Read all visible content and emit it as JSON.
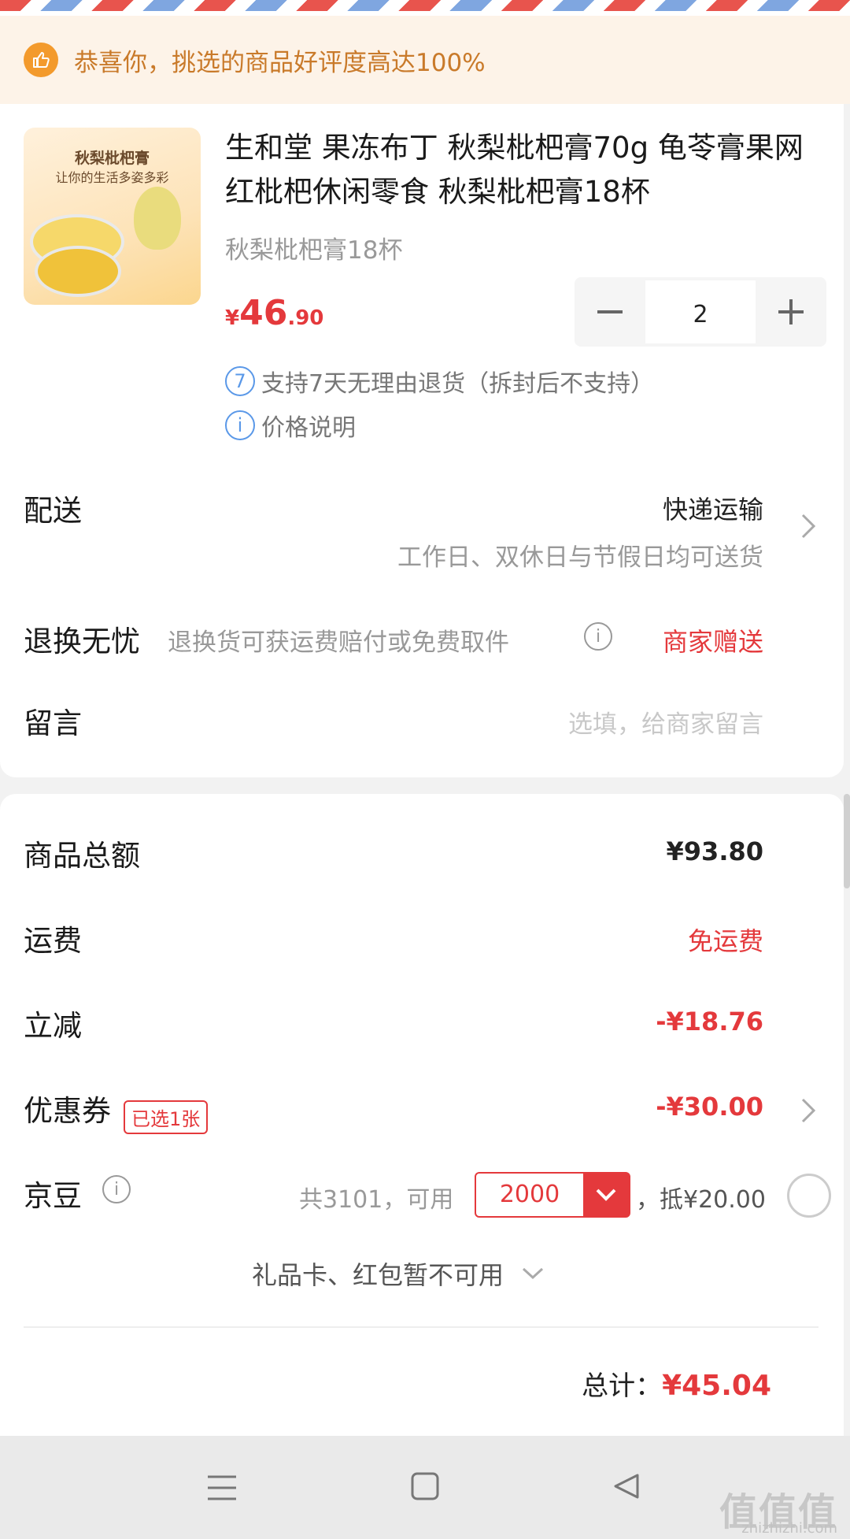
{
  "banner": {
    "icon": "thumbs-up-icon",
    "text": "恭喜你，挑选的商品好评度高达100%"
  },
  "product": {
    "image_line1": "秋梨枇杷膏",
    "image_line2": "让你的生活多姿多彩",
    "title": "生和堂 果冻布丁 秋梨枇杷膏70g 龟苓膏果网红枇杷休闲零食 秋梨枇杷膏18杯",
    "variant": "秋梨枇杷膏18杯",
    "price": {
      "symbol": "¥",
      "integer": "46",
      "decimal": ".90"
    },
    "quantity": "2",
    "services": [
      {
        "icon": "7",
        "text": "支持7天无理由退货（拆封后不支持）"
      },
      {
        "icon": "i",
        "text": "价格说明"
      }
    ]
  },
  "delivery": {
    "label": "配送",
    "method": "快递运输",
    "note": "工作日、双休日与节假日均可送货"
  },
  "returns": {
    "label": "退换无忧",
    "desc": "退换货可获运费赔付或免费取件",
    "value": "商家赠送"
  },
  "message": {
    "label": "留言",
    "placeholder": "选填，给商家留言"
  },
  "summary": {
    "goods_total": {
      "label": "商品总额",
      "value": "¥93.80"
    },
    "shipping": {
      "label": "运费",
      "value": "免运费"
    },
    "discount": {
      "label": "立减",
      "value": "-¥18.76"
    },
    "coupon": {
      "label": "优惠券",
      "badge": "已选1张",
      "value": "-¥30.00"
    },
    "jd_beans": {
      "label": "京豆",
      "total_text": "共3101，可用",
      "selected": "2000",
      "offset": "，抵¥20.00"
    },
    "gift_card": "礼品卡、红包暂不可用",
    "total_label": "总计：",
    "total_value": "¥45.04"
  },
  "watermark": {
    "main": "值值值",
    "sub": "zhizhizhi.com"
  },
  "colors": {
    "accent_red": "#e4393c",
    "banner_bg": "#fdf3e8",
    "banner_text": "#c97a2a",
    "info_blue": "#5a98e8"
  }
}
